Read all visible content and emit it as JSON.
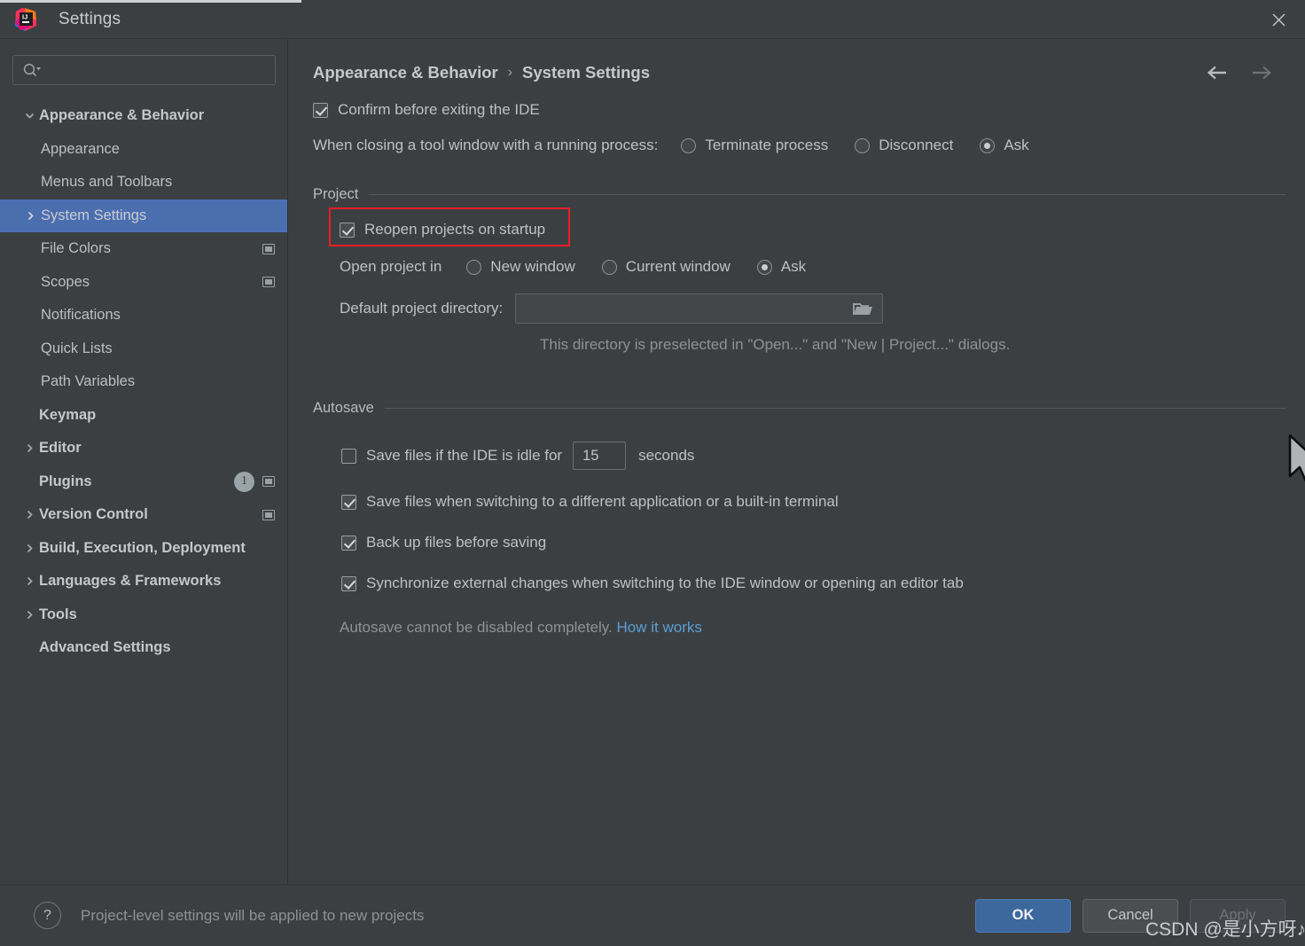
{
  "window": {
    "title": "Settings",
    "logo_icon": "intellij-idea-logo",
    "close_icon": "close-icon"
  },
  "sidebar": {
    "search": {
      "placeholder": "",
      "value": "",
      "icon": "search-icon",
      "dropdown_icon": "chevron-down-icon"
    },
    "items": [
      {
        "label": "Appearance & Behavior",
        "level": 0,
        "twisty": "chevron-down-icon",
        "selected": false,
        "badge": null,
        "project_icon": false
      },
      {
        "label": "Appearance",
        "level": 1,
        "twisty": null,
        "selected": false,
        "badge": null,
        "project_icon": false
      },
      {
        "label": "Menus and Toolbars",
        "level": 1,
        "twisty": null,
        "selected": false,
        "badge": null,
        "project_icon": false
      },
      {
        "label": "System Settings",
        "level": 1,
        "twisty": "chevron-right-icon",
        "selected": true,
        "badge": null,
        "project_icon": false
      },
      {
        "label": "File Colors",
        "level": 1,
        "twisty": null,
        "selected": false,
        "badge": null,
        "project_icon": true
      },
      {
        "label": "Scopes",
        "level": 1,
        "twisty": null,
        "selected": false,
        "badge": null,
        "project_icon": true
      },
      {
        "label": "Notifications",
        "level": 1,
        "twisty": null,
        "selected": false,
        "badge": null,
        "project_icon": false
      },
      {
        "label": "Quick Lists",
        "level": 1,
        "twisty": null,
        "selected": false,
        "badge": null,
        "project_icon": false
      },
      {
        "label": "Path Variables",
        "level": 1,
        "twisty": null,
        "selected": false,
        "badge": null,
        "project_icon": false
      },
      {
        "label": "Keymap",
        "level": 0,
        "twisty": null,
        "selected": false,
        "badge": null,
        "project_icon": false
      },
      {
        "label": "Editor",
        "level": 0,
        "twisty": "chevron-right-icon",
        "selected": false,
        "badge": null,
        "project_icon": false
      },
      {
        "label": "Plugins",
        "level": 0,
        "twisty": null,
        "selected": false,
        "badge": "1",
        "project_icon": true
      },
      {
        "label": "Version Control",
        "level": 0,
        "twisty": "chevron-right-icon",
        "selected": false,
        "badge": null,
        "project_icon": true
      },
      {
        "label": "Build, Execution, Deployment",
        "level": 0,
        "twisty": "chevron-right-icon",
        "selected": false,
        "badge": null,
        "project_icon": false
      },
      {
        "label": "Languages & Frameworks",
        "level": 0,
        "twisty": "chevron-right-icon",
        "selected": false,
        "badge": null,
        "project_icon": false
      },
      {
        "label": "Tools",
        "level": 0,
        "twisty": "chevron-right-icon",
        "selected": false,
        "badge": null,
        "project_icon": false
      },
      {
        "label": "Advanced Settings",
        "level": 0,
        "twisty": null,
        "selected": false,
        "badge": null,
        "project_icon": false
      }
    ]
  },
  "main": {
    "breadcrumb": {
      "parent": "Appearance & Behavior",
      "separator": "›",
      "current": "System Settings"
    },
    "nav": {
      "back_icon": "arrow-left-icon",
      "forward_icon": "arrow-right-icon"
    },
    "confirm_exit": {
      "label": "Confirm before exiting the IDE",
      "checked": true
    },
    "closing_tool_window": {
      "label": "When closing a tool window with a running process:",
      "options": [
        "Terminate process",
        "Disconnect",
        "Ask"
      ],
      "selected": "Ask"
    },
    "project": {
      "section_title": "Project",
      "reopen": {
        "label": "Reopen projects on startup",
        "checked": true,
        "highlighted": true,
        "highlight_color": "#ec1c24"
      },
      "open_project_in": {
        "label": "Open project in",
        "options": [
          "New window",
          "Current window",
          "Ask"
        ],
        "selected": "Ask"
      },
      "default_directory": {
        "label": "Default project directory:",
        "value": "",
        "browse_icon": "folder-icon"
      },
      "hint": "This directory is preselected in \"Open...\" and \"New | Project...\" dialogs."
    },
    "autosave": {
      "section_title": "Autosave",
      "idle": {
        "label_before": "Save files if the IDE is idle for",
        "value": "15",
        "label_after": "seconds",
        "checked": false
      },
      "options": [
        {
          "label": "Save files when switching to a different application or a built-in terminal",
          "checked": true
        },
        {
          "label": "Back up files before saving",
          "checked": true
        },
        {
          "label": "Synchronize external changes when switching to the IDE window or opening an editor tab",
          "checked": true
        }
      ],
      "note": "Autosave cannot be disabled completely.",
      "link": "How it works"
    }
  },
  "bottom": {
    "help_icon": "question-mark-icon",
    "note": "Project-level settings will be applied to new projects",
    "ok_label": "OK",
    "cancel_label": "Cancel",
    "apply_label": "Apply"
  },
  "watermark": "CSDN @是小方呀♪",
  "colors": {
    "accent_selection": "#4b6eaf",
    "primary_button": "#3c689e",
    "highlight_box": "#ec1c24",
    "link": "#5a9fd4",
    "panel_bg": "#3c3f41"
  }
}
